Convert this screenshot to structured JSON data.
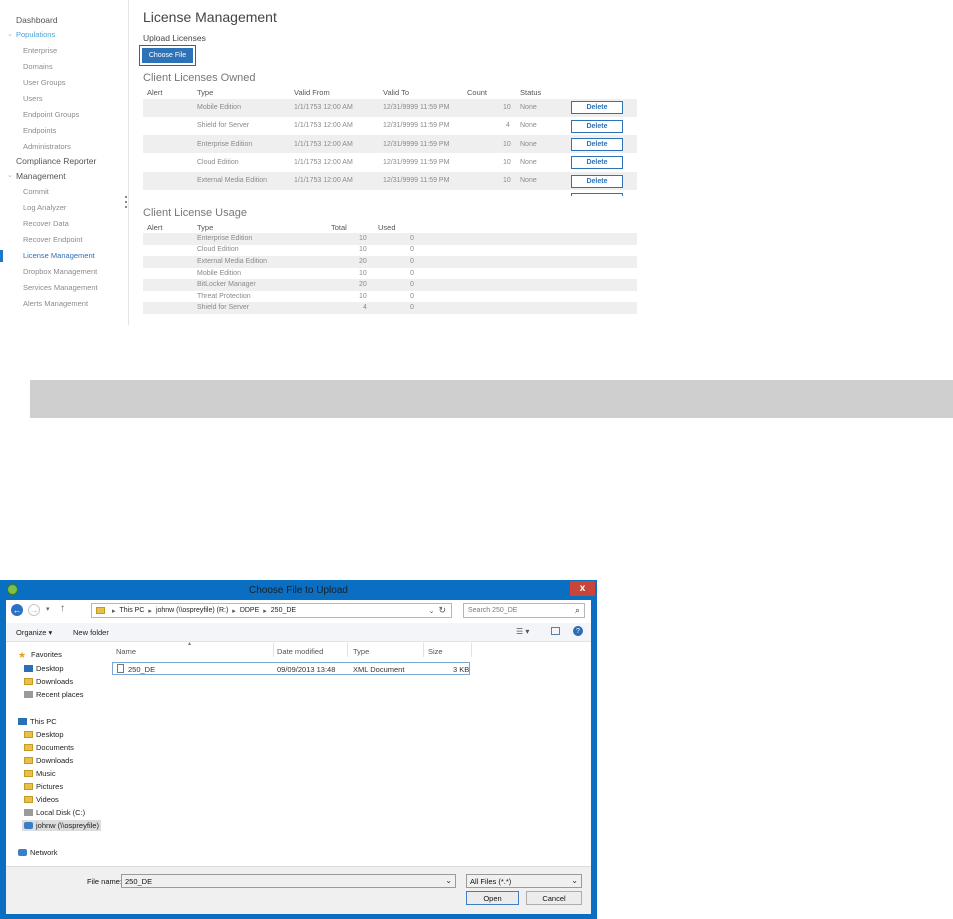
{
  "sidebar": {
    "items": [
      {
        "label": "Dashboard"
      },
      {
        "label": "Populations"
      },
      {
        "label": "Enterprise"
      },
      {
        "label": "Domains"
      },
      {
        "label": "User Groups"
      },
      {
        "label": "Users"
      },
      {
        "label": "Endpoint Groups"
      },
      {
        "label": "Endpoints"
      },
      {
        "label": "Administrators"
      },
      {
        "label": "Compliance Reporter"
      },
      {
        "label": "Management"
      },
      {
        "label": "Commit"
      },
      {
        "label": "Log Analyzer"
      },
      {
        "label": "Recover Data"
      },
      {
        "label": "Recover Endpoint"
      },
      {
        "label": "License Management"
      },
      {
        "label": "Dropbox Management"
      },
      {
        "label": "Services Management"
      },
      {
        "label": "Alerts Management"
      }
    ]
  },
  "main": {
    "title": "License Management",
    "upload_label": "Upload Licenses",
    "choose_file_label": "Choose File",
    "owned": {
      "title": "Client Licenses Owned",
      "headers": [
        "Alert",
        "Type",
        "Valid From",
        "Valid To",
        "Count",
        "Status"
      ],
      "rows": [
        {
          "type": "Mobile Edition",
          "from": "1/1/1753 12:00 AM",
          "to": "12/31/9999 11:59 PM",
          "count": "10",
          "status": "None",
          "action": "Delete"
        },
        {
          "type": "Shield for Server",
          "from": "1/1/1753 12:00 AM",
          "to": "12/31/9999 11:59 PM",
          "count": "4",
          "status": "None",
          "action": "Delete"
        },
        {
          "type": "Enterprise Edition",
          "from": "1/1/1753 12:00 AM",
          "to": "12/31/9999 11:59 PM",
          "count": "10",
          "status": "None",
          "action": "Delete"
        },
        {
          "type": "Cloud Edition",
          "from": "1/1/1753 12:00 AM",
          "to": "12/31/9999 11:59 PM",
          "count": "10",
          "status": "None",
          "action": "Delete"
        },
        {
          "type": "External Media Edition",
          "from": "1/1/1753 12:00 AM",
          "to": "12/31/9999 11:59 PM",
          "count": "10",
          "status": "None",
          "action": "Delete"
        }
      ]
    },
    "usage": {
      "title": "Client License Usage",
      "headers": [
        "Alert",
        "Type",
        "Total",
        "Used"
      ],
      "rows": [
        {
          "type": "Enterprise Edition",
          "total": "10",
          "used": "0"
        },
        {
          "type": "Cloud Edition",
          "total": "10",
          "used": "0"
        },
        {
          "type": "External Media Edition",
          "total": "20",
          "used": "0"
        },
        {
          "type": "Mobile Edition",
          "total": "10",
          "used": "0"
        },
        {
          "type": "BitLocker Manager",
          "total": "20",
          "used": "0"
        },
        {
          "type": "Threat Protection",
          "total": "10",
          "used": "0"
        },
        {
          "type": "Shield for Server",
          "total": "4",
          "used": "0"
        }
      ]
    }
  },
  "dialog": {
    "title": "Choose File to Upload",
    "close_label": "x",
    "breadcrumb": [
      "This PC",
      "johnw (\\\\ospreyfile) (R:)",
      "DDPE",
      "250_DE"
    ],
    "search_placeholder": "Search 250_DE",
    "organize_label": "Organize ▾",
    "new_folder_label": "New folder",
    "tree": {
      "favorites": "Favorites",
      "fav_items": [
        "Desktop",
        "Downloads",
        "Recent places"
      ],
      "this_pc": "This PC",
      "pc_items": [
        "Desktop",
        "Documents",
        "Downloads",
        "Music",
        "Pictures",
        "Videos",
        "Local Disk (C:)",
        "johnw (\\\\ospreyfile)"
      ],
      "network": "Network"
    },
    "columns": [
      "Name",
      "Date modified",
      "Type",
      "Size"
    ],
    "files": [
      {
        "name": "250_DE",
        "modified": "09/09/2013 13:48",
        "type": "XML Document",
        "size": "3 KB"
      }
    ],
    "file_name_label": "File name:",
    "file_name_value": "250_DE",
    "filter_value": "All Files (*.*)",
    "open_label": "Open",
    "cancel_label": "Cancel"
  },
  "colors": {
    "accent_blue": "#2e73b8",
    "highlight_red": "#d9232d",
    "dialog_frame": "#0a6fc2"
  }
}
